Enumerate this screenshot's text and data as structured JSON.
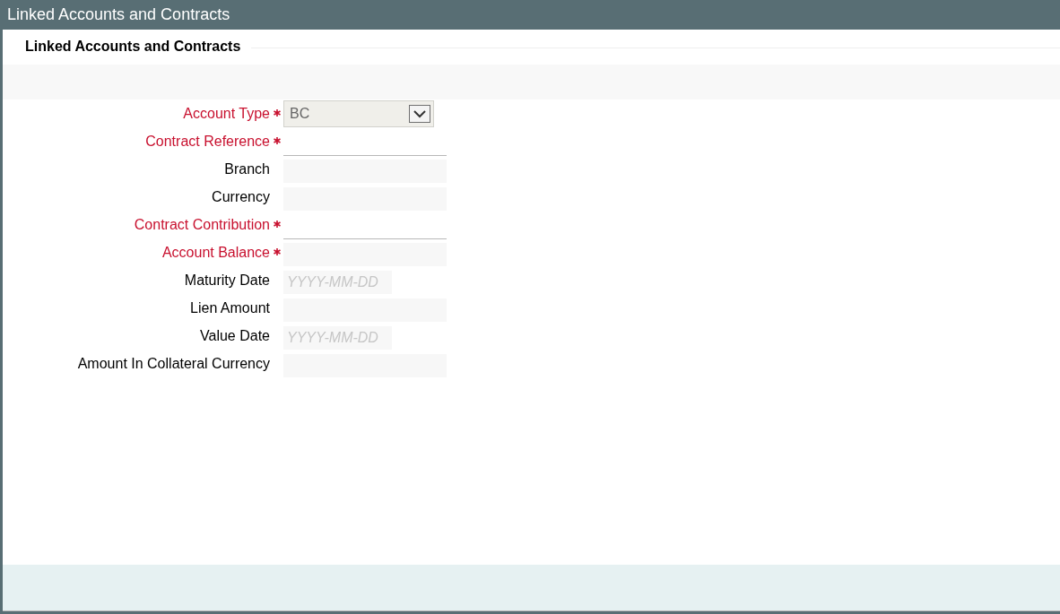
{
  "window": {
    "title": "Linked Accounts and Contracts"
  },
  "section": {
    "title": "Linked Accounts and Contracts"
  },
  "fields": [
    {
      "label": "Account Type",
      "required": true,
      "kind": "select",
      "value": "BC"
    },
    {
      "label": "Contract Reference",
      "required": true,
      "kind": "line"
    },
    {
      "label": "Branch",
      "required": false,
      "kind": "text"
    },
    {
      "label": "Currency",
      "required": false,
      "kind": "text"
    },
    {
      "label": "Contract Contribution",
      "required": true,
      "kind": "line"
    },
    {
      "label": "Account Balance",
      "required": true,
      "kind": "text"
    },
    {
      "label": "Maturity Date",
      "required": false,
      "kind": "date",
      "placeholder": "YYYY-MM-DD"
    },
    {
      "label": "Lien Amount",
      "required": false,
      "kind": "text"
    },
    {
      "label": "Value Date",
      "required": false,
      "kind": "date",
      "placeholder": "YYYY-MM-DD"
    },
    {
      "label": "Amount In Collateral Currency",
      "required": false,
      "kind": "text"
    }
  ]
}
